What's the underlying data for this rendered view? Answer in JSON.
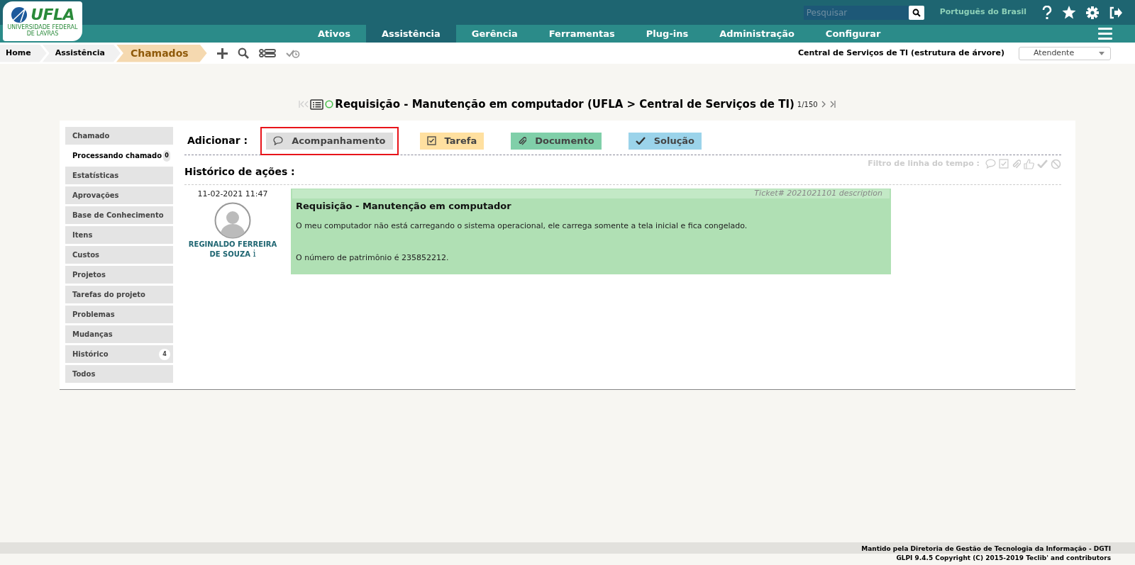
{
  "logo": {
    "text": "UFLA",
    "subtitle": "UNIVERSIDADE FEDERAL DE LAVRAS"
  },
  "top_bar": {
    "search": {
      "placeholder": "Pesquisar"
    },
    "language": "Português do Brasil"
  },
  "main_menu": [
    {
      "label": "Ativos",
      "selected": false
    },
    {
      "label": "Assistência",
      "selected": true
    },
    {
      "label": "Gerência",
      "selected": false
    },
    {
      "label": "Ferramentas",
      "selected": false
    },
    {
      "label": "Plug-ins",
      "selected": false
    },
    {
      "label": "Administração",
      "selected": false
    },
    {
      "label": "Configurar",
      "selected": false
    }
  ],
  "breadcrumb": [
    {
      "label": "Home",
      "current": false
    },
    {
      "label": "Assistência",
      "current": false
    },
    {
      "label": "Chamados",
      "current": true
    }
  ],
  "entity": "Central de Serviços de TI (estrutura de árvore)",
  "profile_select": {
    "value": "Atendente"
  },
  "ticket": {
    "title": "Requisição - Manutenção em computador (UFLA > Central de Serviços de TI)",
    "position": "1/150"
  },
  "sidebar": [
    {
      "label": "Chamado",
      "selected": false
    },
    {
      "label": "Processando chamado",
      "selected": true,
      "count": "0"
    },
    {
      "label": "Estatísticas",
      "selected": false
    },
    {
      "label": "Aprovações",
      "selected": false
    },
    {
      "label": "Base de Conhecimento",
      "selected": false
    },
    {
      "label": "Itens",
      "selected": false
    },
    {
      "label": "Custos",
      "selected": false
    },
    {
      "label": "Projetos",
      "selected": false
    },
    {
      "label": "Tarefas do projeto",
      "selected": false
    },
    {
      "label": "Problemas",
      "selected": false
    },
    {
      "label": "Mudanças",
      "selected": false
    },
    {
      "label": "Histórico",
      "selected": false,
      "count": "4"
    },
    {
      "label": "Todos",
      "selected": false
    }
  ],
  "add_label": "Adicionar :",
  "add_buttons": [
    {
      "kind": "followup",
      "label": "Acompanhamento",
      "highlighted": true
    },
    {
      "kind": "task",
      "label": "Tarefa",
      "highlighted": false
    },
    {
      "kind": "document",
      "label": "Documento",
      "highlighted": false
    },
    {
      "kind": "solution",
      "label": "Solução",
      "highlighted": false
    }
  ],
  "history_title": "Histórico de ações :",
  "timeline_filter_label": "Filtro de linha do tempo :",
  "entries": [
    {
      "date": "11-02-2021 11:47",
      "author": "REGINALDO FERREIRA DE SOUZA",
      "info_mark": "i",
      "tag": "Ticket# 2021021101 description",
      "title": "Requisição - Manutenção em computador",
      "paragraphs": [
        "O meu computador não está carregando o sistema operacional, ele carrega somente a tela inicial e fica congelado.",
        "O número de patrimônio é 235852212."
      ]
    }
  ],
  "footer": [
    "Mantido pela Diretoria de Gestão de Tecnologia da Informação - DGTI",
    "GLPI 9.4.5 Copyright (C) 2015-2019 Teclib' and contributors"
  ]
}
